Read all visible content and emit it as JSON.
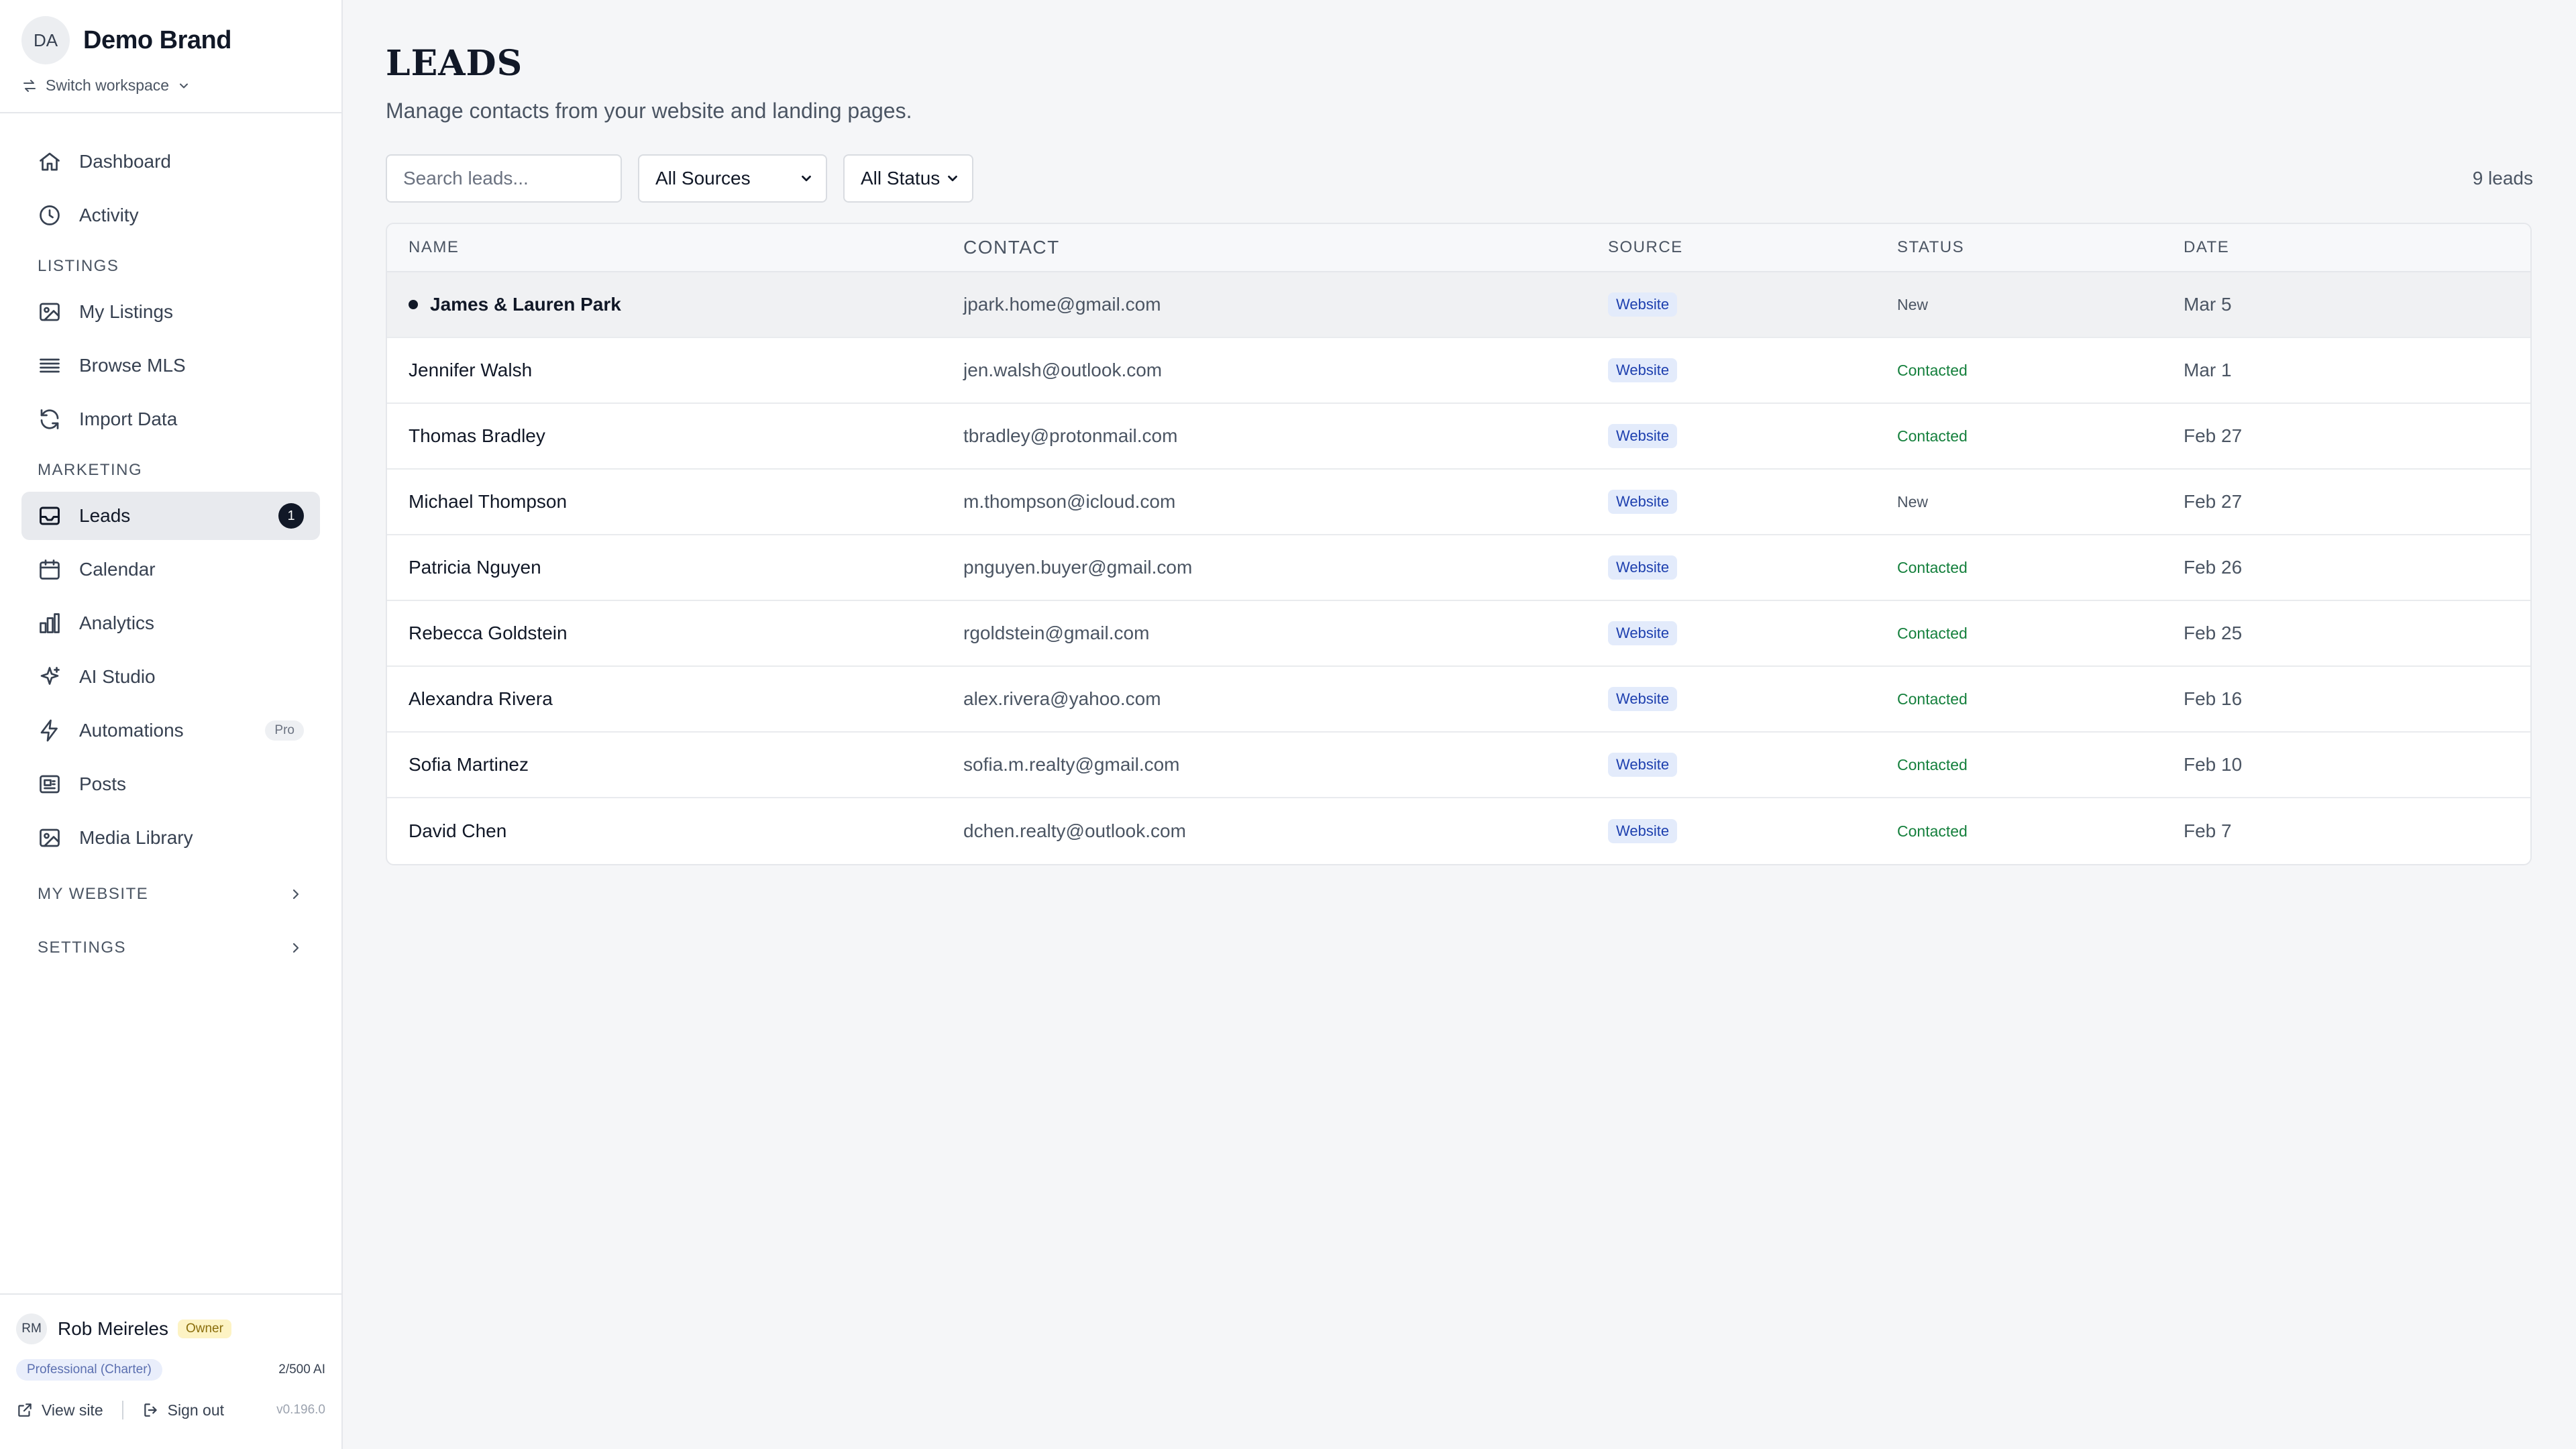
{
  "brand": {
    "initials": "DA",
    "name": "Demo Brand",
    "switch_label": "Switch workspace"
  },
  "nav": {
    "top": [
      {
        "id": "dashboard",
        "label": "Dashboard",
        "icon": "home-icon"
      },
      {
        "id": "activity",
        "label": "Activity",
        "icon": "clock-icon"
      }
    ],
    "sections": {
      "listings": "LISTINGS",
      "marketing": "MARKETING",
      "my_website": "MY WEBSITE",
      "settings": "SETTINGS"
    },
    "listings": [
      {
        "label": "My Listings",
        "icon": "image-icon"
      },
      {
        "label": "Browse MLS",
        "icon": "list-icon"
      },
      {
        "label": "Import Data",
        "icon": "refresh-icon"
      }
    ],
    "marketing": [
      {
        "label": "Leads",
        "icon": "inbox-icon",
        "badge": "1"
      },
      {
        "label": "Calendar",
        "icon": "calendar-icon"
      },
      {
        "label": "Analytics",
        "icon": "bar-chart-icon"
      },
      {
        "label": "AI Studio",
        "icon": "sparkles-icon"
      },
      {
        "label": "Automations",
        "icon": "bolt-icon",
        "pill": "Pro"
      },
      {
        "label": "Posts",
        "icon": "newspaper-icon"
      },
      {
        "label": "Media Library",
        "icon": "image-icon"
      }
    ]
  },
  "footer": {
    "user_initials": "RM",
    "user_name": "Rob Meireles",
    "role": "Owner",
    "plan": "Professional (Charter)",
    "usage": "2/500 AI",
    "view_site": "View site",
    "sign_out": "Sign out",
    "version": "v0.196.0"
  },
  "page": {
    "title": "LEADS",
    "subtitle": "Manage contacts from your website and landing pages.",
    "search_placeholder": "Search leads...",
    "source_filter": "All Sources",
    "status_filter": "All Status",
    "count": "9 leads"
  },
  "table": {
    "headers": {
      "name": "NAME",
      "contact": "CONTACT",
      "source": "SOURCE",
      "status": "STATUS",
      "date": "DATE"
    },
    "rows": [
      {
        "name": "James & Lauren Park",
        "contact": "jpark.home@gmail.com",
        "source": "Website",
        "status": "New",
        "date": "Mar 5",
        "unread": true
      },
      {
        "name": "Jennifer Walsh",
        "contact": "jen.walsh@outlook.com",
        "source": "Website",
        "status": "Contacted",
        "date": "Mar 1"
      },
      {
        "name": "Thomas Bradley",
        "contact": "tbradley@protonmail.com",
        "source": "Website",
        "status": "Contacted",
        "date": "Feb 27"
      },
      {
        "name": "Michael Thompson",
        "contact": "m.thompson@icloud.com",
        "source": "Website",
        "status": "New",
        "date": "Feb 27"
      },
      {
        "name": "Patricia Nguyen",
        "contact": "pnguyen.buyer@gmail.com",
        "source": "Website",
        "status": "Contacted",
        "date": "Feb 26"
      },
      {
        "name": "Rebecca Goldstein",
        "contact": "rgoldstein@gmail.com",
        "source": "Website",
        "status": "Contacted",
        "date": "Feb 25"
      },
      {
        "name": "Alexandra Rivera",
        "contact": "alex.rivera@yahoo.com",
        "source": "Website",
        "status": "Contacted",
        "date": "Feb 16"
      },
      {
        "name": "Sofia Martinez",
        "contact": "sofia.m.realty@gmail.com",
        "source": "Website",
        "status": "Contacted",
        "date": "Feb 10"
      },
      {
        "name": "David Chen",
        "contact": "dchen.realty@outlook.com",
        "source": "Website",
        "status": "Contacted",
        "date": "Feb 7"
      }
    ]
  },
  "colors": {
    "accent_dark": "#111827",
    "status_contacted": "#15803d",
    "source_pill_bg": "#e3ebfb",
    "source_pill_text": "#1e40af",
    "owner_pill_bg": "#fdf3c4"
  }
}
